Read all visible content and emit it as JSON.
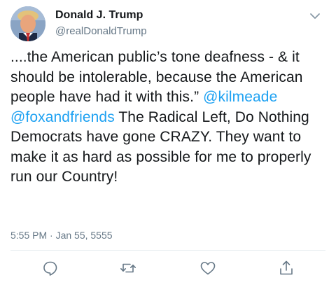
{
  "user": {
    "display_name": "Donald J. Trump",
    "handle": "@realDonaldTrump",
    "avatar_icon": "profile-photo"
  },
  "tweet": {
    "text_part1": "....the American public’s tone deafness - & it should be intolerable, because the American people have had it with this.” ",
    "mention1": "@kilmeade",
    "space": " ",
    "mention2": "@foxandfriends",
    "text_part2": " The Radical Left, Do Nothing Democrats have gone CRAZY. They want to make it as hard as possible for me to properly run our Country!",
    "timestamp": "5:55 PM · Jan 55, 5555"
  },
  "actions": {
    "reply_icon": "reply-icon",
    "retweet_icon": "retweet-icon",
    "like_icon": "heart-icon",
    "share_icon": "share-icon"
  },
  "colors": {
    "link": "#1da1f2",
    "muted": "#657786",
    "text": "#14171a",
    "divider": "#e6ecf0"
  }
}
